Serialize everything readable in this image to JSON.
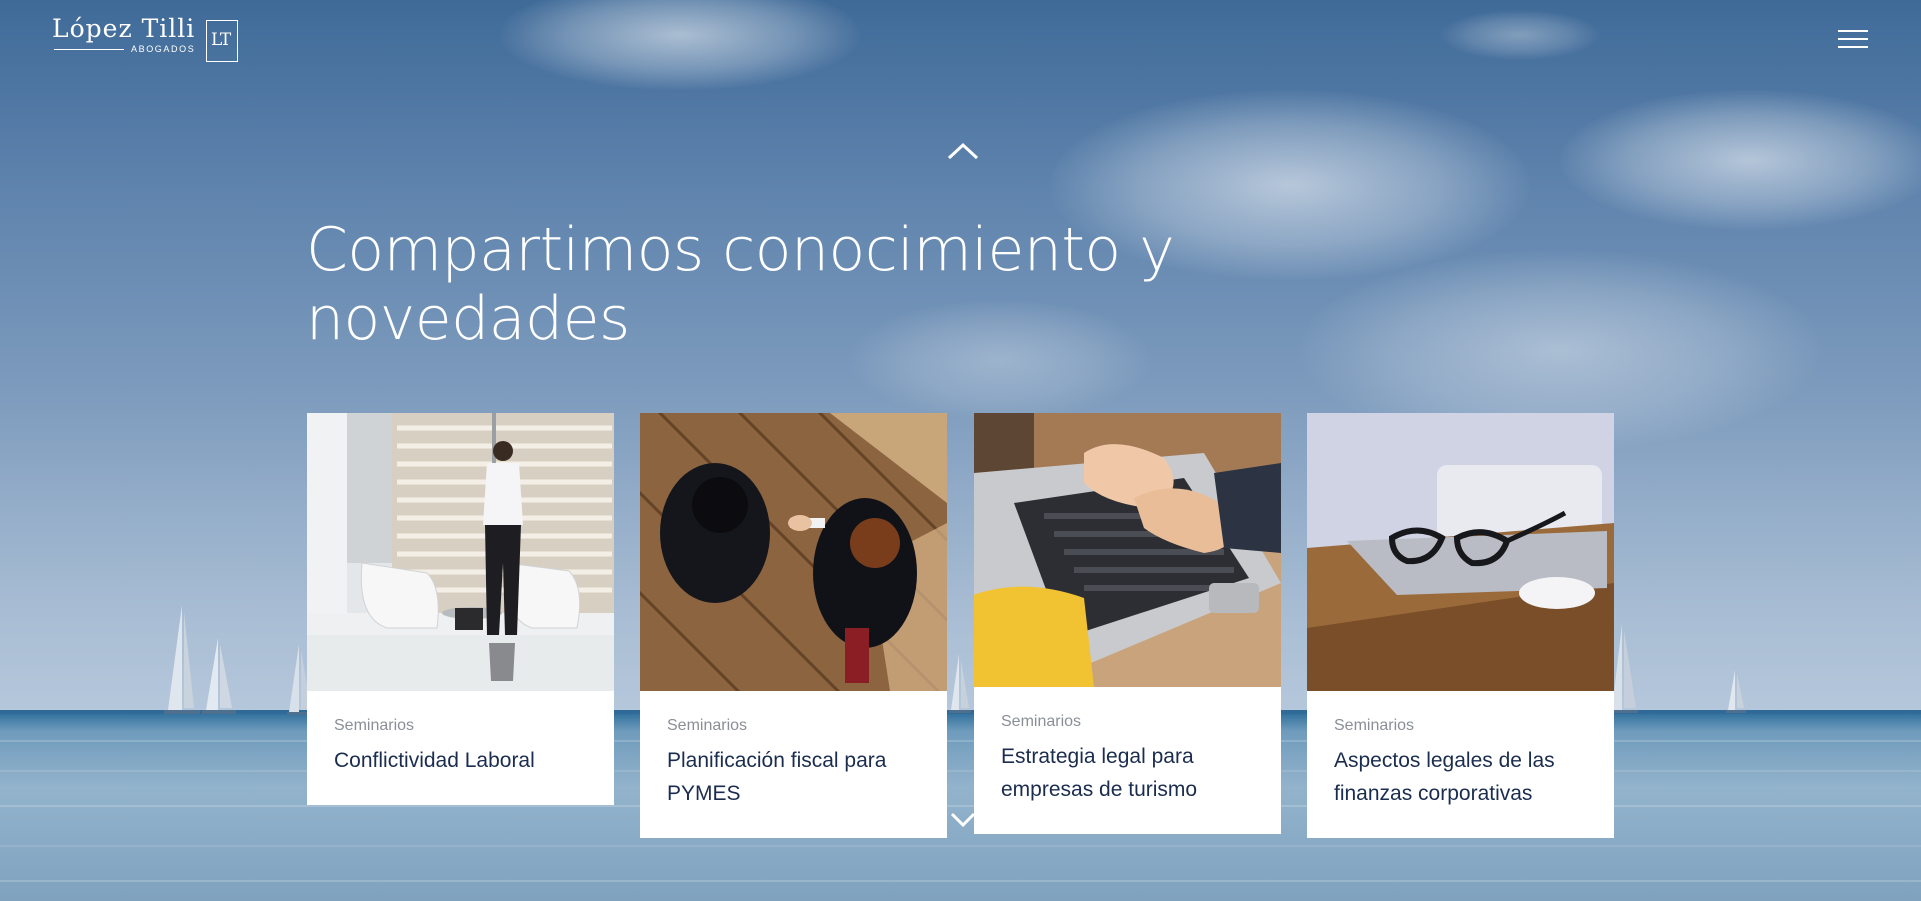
{
  "header": {
    "logo_name": "López Tilli",
    "logo_tagline": "ABOGADOS",
    "logo_monogram": "LT",
    "menu_icon": "hamburger-menu-icon"
  },
  "navigation": {
    "scroll_up_icon": "chevron-up-icon",
    "scroll_down_icon": "chevron-down-icon"
  },
  "hero": {
    "headline": "Compartimos conocimiento y novedades"
  },
  "cards": [
    {
      "category": "Seminarios",
      "title": "Conflictividad Laboral",
      "image": "businessman-at-window-photo"
    },
    {
      "category": "Seminarios",
      "title": "Planificación fiscal para PYMES",
      "image": "business-handshake-photo"
    },
    {
      "category": "Seminarios",
      "title": "Estrategia legal para empresas de turismo",
      "image": "typing-on-laptop-photo"
    },
    {
      "category": "Seminarios",
      "title": "Aspectos legales de las finanzas corporativas",
      "image": "glasses-on-laptop-photo"
    }
  ],
  "colors": {
    "card_title": "#1b2d4f",
    "card_category": "#8a8f97",
    "text_on_hero": "#ffffff"
  }
}
